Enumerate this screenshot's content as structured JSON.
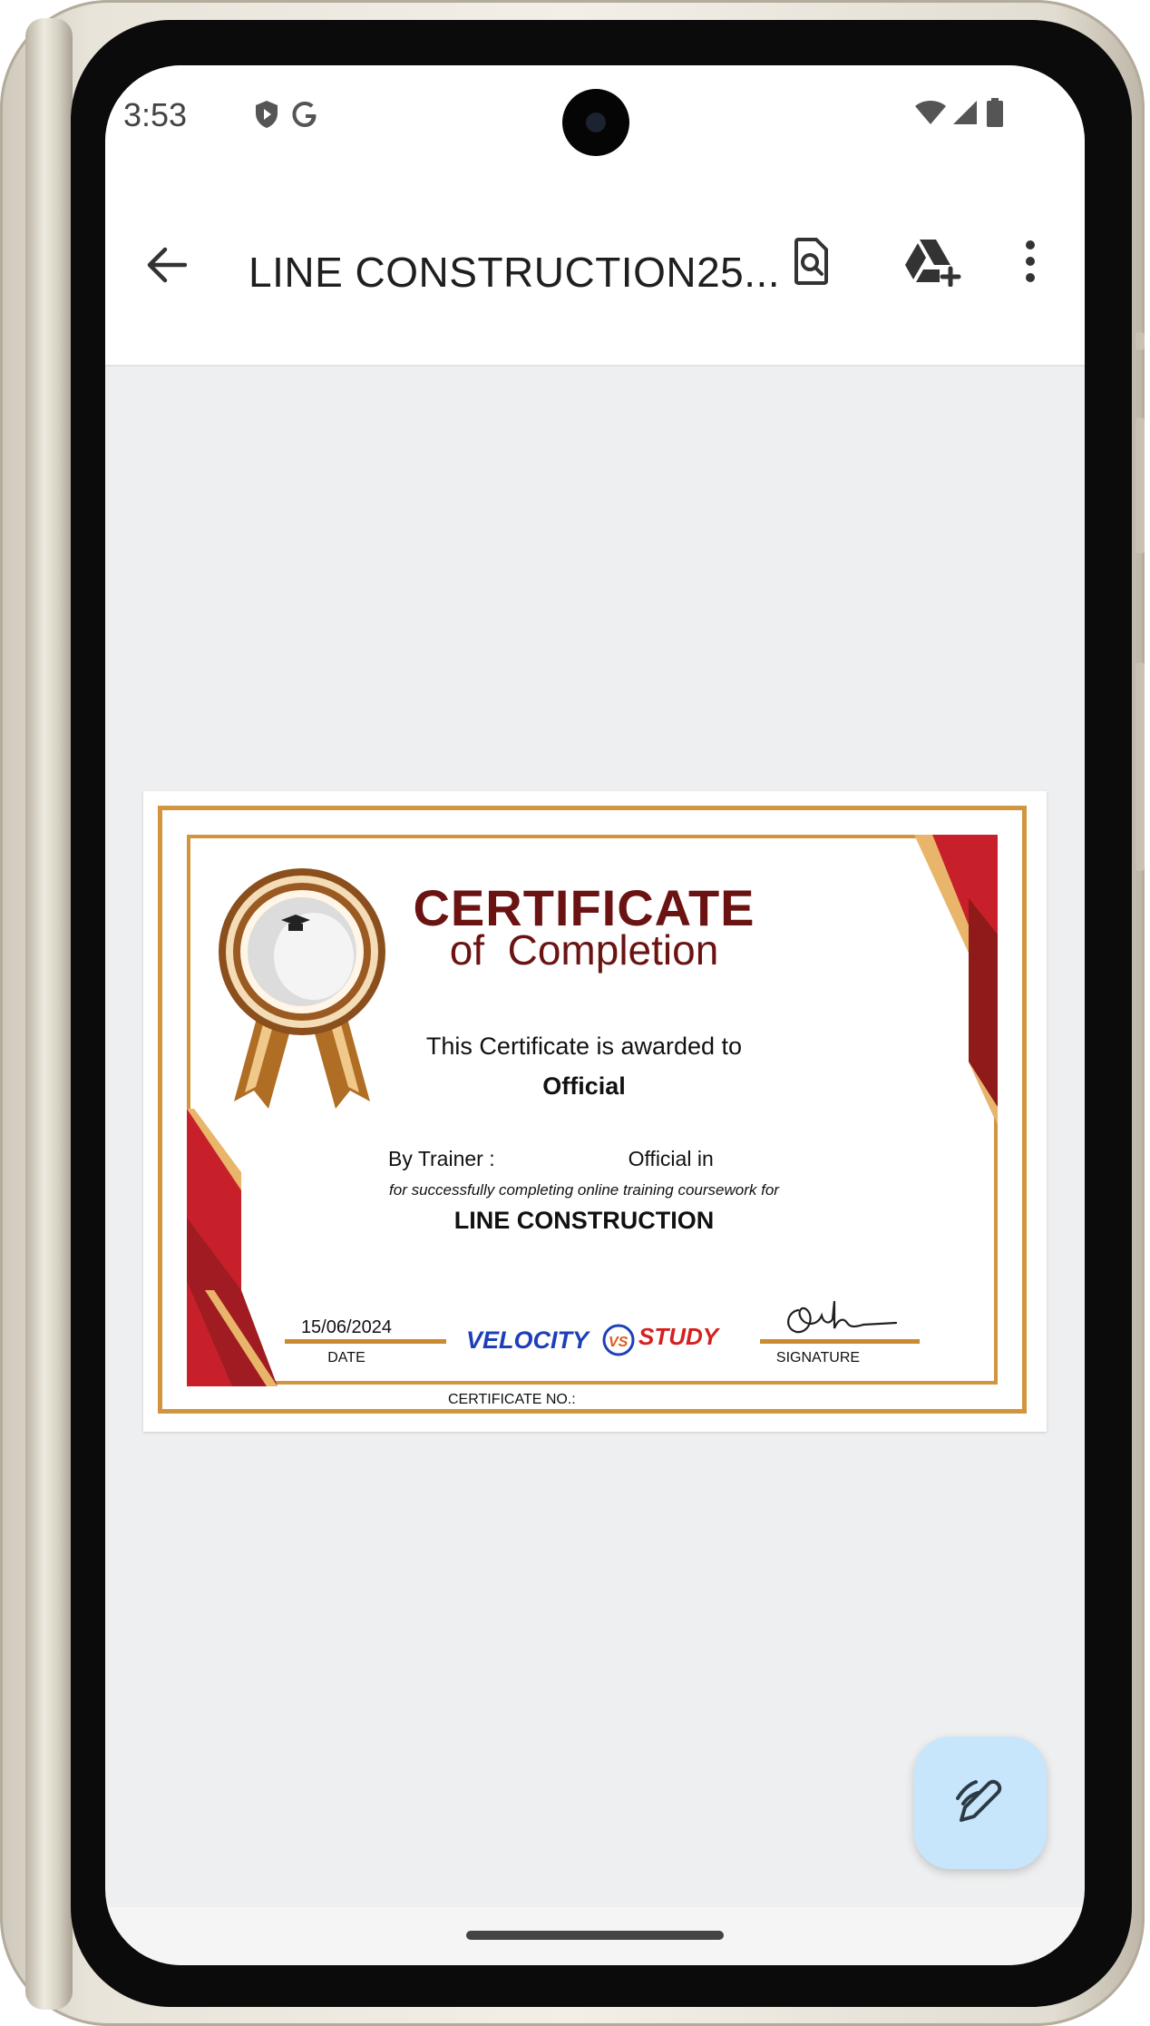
{
  "status_bar": {
    "time": "3:53",
    "left_icons": [
      "play-protect-icon",
      "google-g-icon"
    ],
    "right_icons": [
      "wifi-icon",
      "signal-icon",
      "battery-icon"
    ]
  },
  "app_bar": {
    "title": "LINE CONSTRUCTION25...",
    "back_icon": "arrow-back-icon",
    "actions": [
      "find-in-file-icon",
      "drive-add-icon",
      "more-vert-icon"
    ]
  },
  "certificate": {
    "heading": "CERTIFICATE",
    "subheading": "of  Completion",
    "awarded_text": "This Certificate is awarded to",
    "recipient": "Official",
    "trainer_text": "By Trainer :                       Official in",
    "success_text": "for successfully completing online training coursework for",
    "course": "LINE CONSTRUCTION",
    "date": "15/06/2024",
    "date_label": "DATE",
    "signature_label": "SIGNATURE",
    "certificate_no_label": "CERTIFICATE NO.:",
    "logo": {
      "left_word": "VELOCITY",
      "monogram": "VS",
      "right_word": "STUDY"
    },
    "colors": {
      "maroon": "#6b1313",
      "gold": "#d1953f",
      "red": "#c8202a"
    }
  },
  "fab": {
    "icon": "edit-pen-icon",
    "color": "#c7e6fb"
  }
}
